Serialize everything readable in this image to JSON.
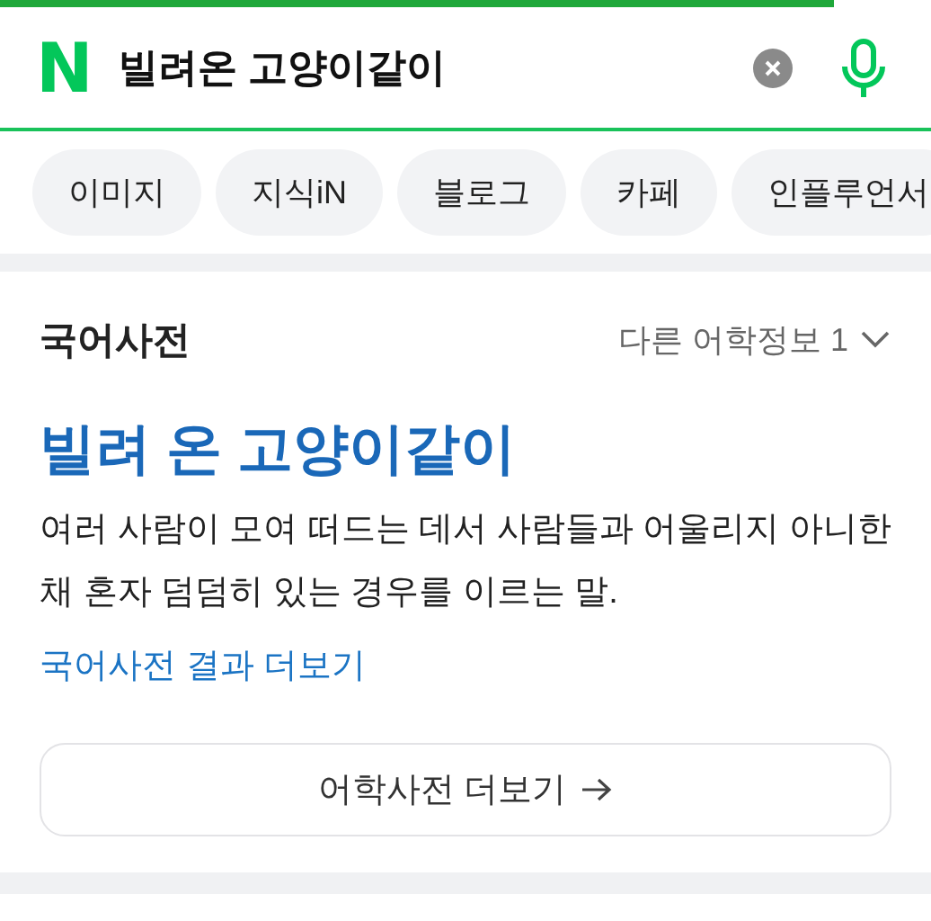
{
  "page_progress": {
    "level": 0.895
  },
  "search": {
    "logo": "N",
    "value": "빌려온 고양이같이"
  },
  "chips": [
    {
      "label": "이미지"
    },
    {
      "label": "지식iN"
    },
    {
      "label": "블로그"
    },
    {
      "label": "카페"
    },
    {
      "label": "인플루언서"
    }
  ],
  "dictionary": {
    "section_title": "국어사전",
    "other_info": "다른 어학정보 1",
    "headword": "빌려 온 고양이같이",
    "definition": "여러 사람이 모여 떠드는 데서 사람들과 어울리지 아니한 채 혼자 덤덤히 있는 경우를 이르는 말.",
    "more_link": "국어사전 결과 더보기",
    "more_button": "어학사전 더보기"
  }
}
